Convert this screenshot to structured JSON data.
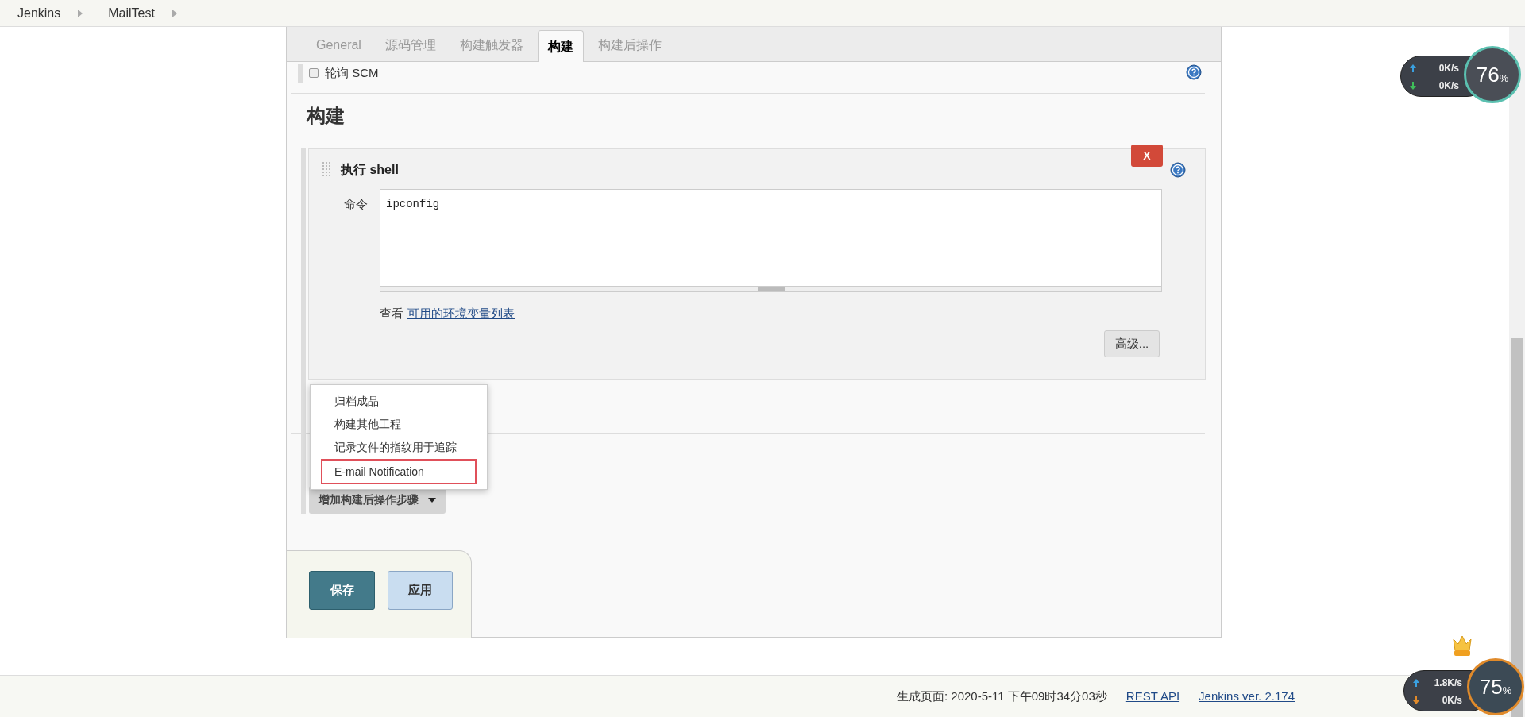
{
  "breadcrumbs": [
    "Jenkins",
    "MailTest"
  ],
  "tabs": [
    {
      "label": "General",
      "selected": false
    },
    {
      "label": "源码管理",
      "selected": false
    },
    {
      "label": "构建触发器",
      "selected": false
    },
    {
      "label": "构建",
      "selected": true
    },
    {
      "label": "构建后操作",
      "selected": false
    }
  ],
  "poll_scm": {
    "label": "轮询 SCM",
    "checked": false
  },
  "section_title": "构建",
  "build_step": {
    "title": "执行 shell",
    "delete_label": "X",
    "command_label": "命令",
    "command": "ipconfig",
    "env_prefix": "查看",
    "env_link": "可用的环境变量列表",
    "advanced_button": "高级..."
  },
  "dropdown_menu": [
    {
      "label": "归档成品",
      "highlighted": false
    },
    {
      "label": "构建其他工程",
      "highlighted": false
    },
    {
      "label": "记录文件的指纹用于追踪",
      "highlighted": false
    },
    {
      "label": "E-mail Notification",
      "highlighted": true
    }
  ],
  "add_post_build_button": "增加构建后操作步骤",
  "save_button": "保存",
  "apply_button": "应用",
  "footer": {
    "generated": "生成页面: 2020-5-11 下午09时34分03秒",
    "links": [
      "REST API",
      "Jenkins ver. 2.174"
    ]
  },
  "speed_widgets": [
    {
      "upload": "0",
      "upload_unit": "K/s",
      "download": "0",
      "download_unit": "K/s",
      "percent": "76",
      "suffix": "%",
      "vip": false
    },
    {
      "upload": "1.8",
      "upload_unit": "K/s",
      "download": "0",
      "download_unit": "K/s",
      "percent": "75",
      "suffix": "%",
      "vip": true
    }
  ]
}
